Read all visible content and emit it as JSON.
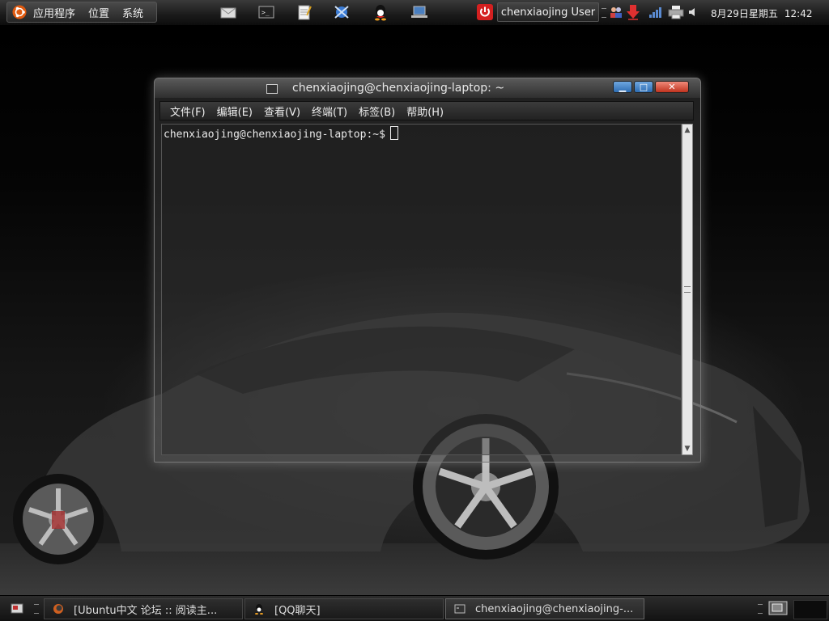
{
  "top_panel": {
    "menus": [
      "应用程序",
      "位置",
      "系统"
    ],
    "launchers": [
      "mail-icon",
      "terminal-icon",
      "text-editor-icon",
      "network-icon",
      "qq-icon",
      "laptop-icon"
    ],
    "user_name": "chenxiaojing User",
    "tray_icons": [
      "power-icon",
      "users-icon",
      "download-icon",
      "signal-icon",
      "printer-icon",
      "volume-icon"
    ],
    "date": "8月29日星期五",
    "time": "12:42"
  },
  "terminal": {
    "title": "chenxiaojing@chenxiaojing-laptop: ~",
    "menus": [
      "文件(F)",
      "编辑(E)",
      "查看(V)",
      "终端(T)",
      "标签(B)",
      "帮助(H)"
    ],
    "prompt": "chenxiaojing@chenxiaojing-laptop:~$"
  },
  "taskbar": {
    "tasks": [
      "[Ubuntu中文 论坛 :: 阅读主...",
      "[QQ聊天]",
      "chenxiaojing@chenxiaojing-..."
    ]
  },
  "colors": {
    "close_button": "#c0331e",
    "min_max_buttons": "#2d6db3",
    "power_icon": "#d42020",
    "ubuntu_orange": "#e05a10"
  }
}
